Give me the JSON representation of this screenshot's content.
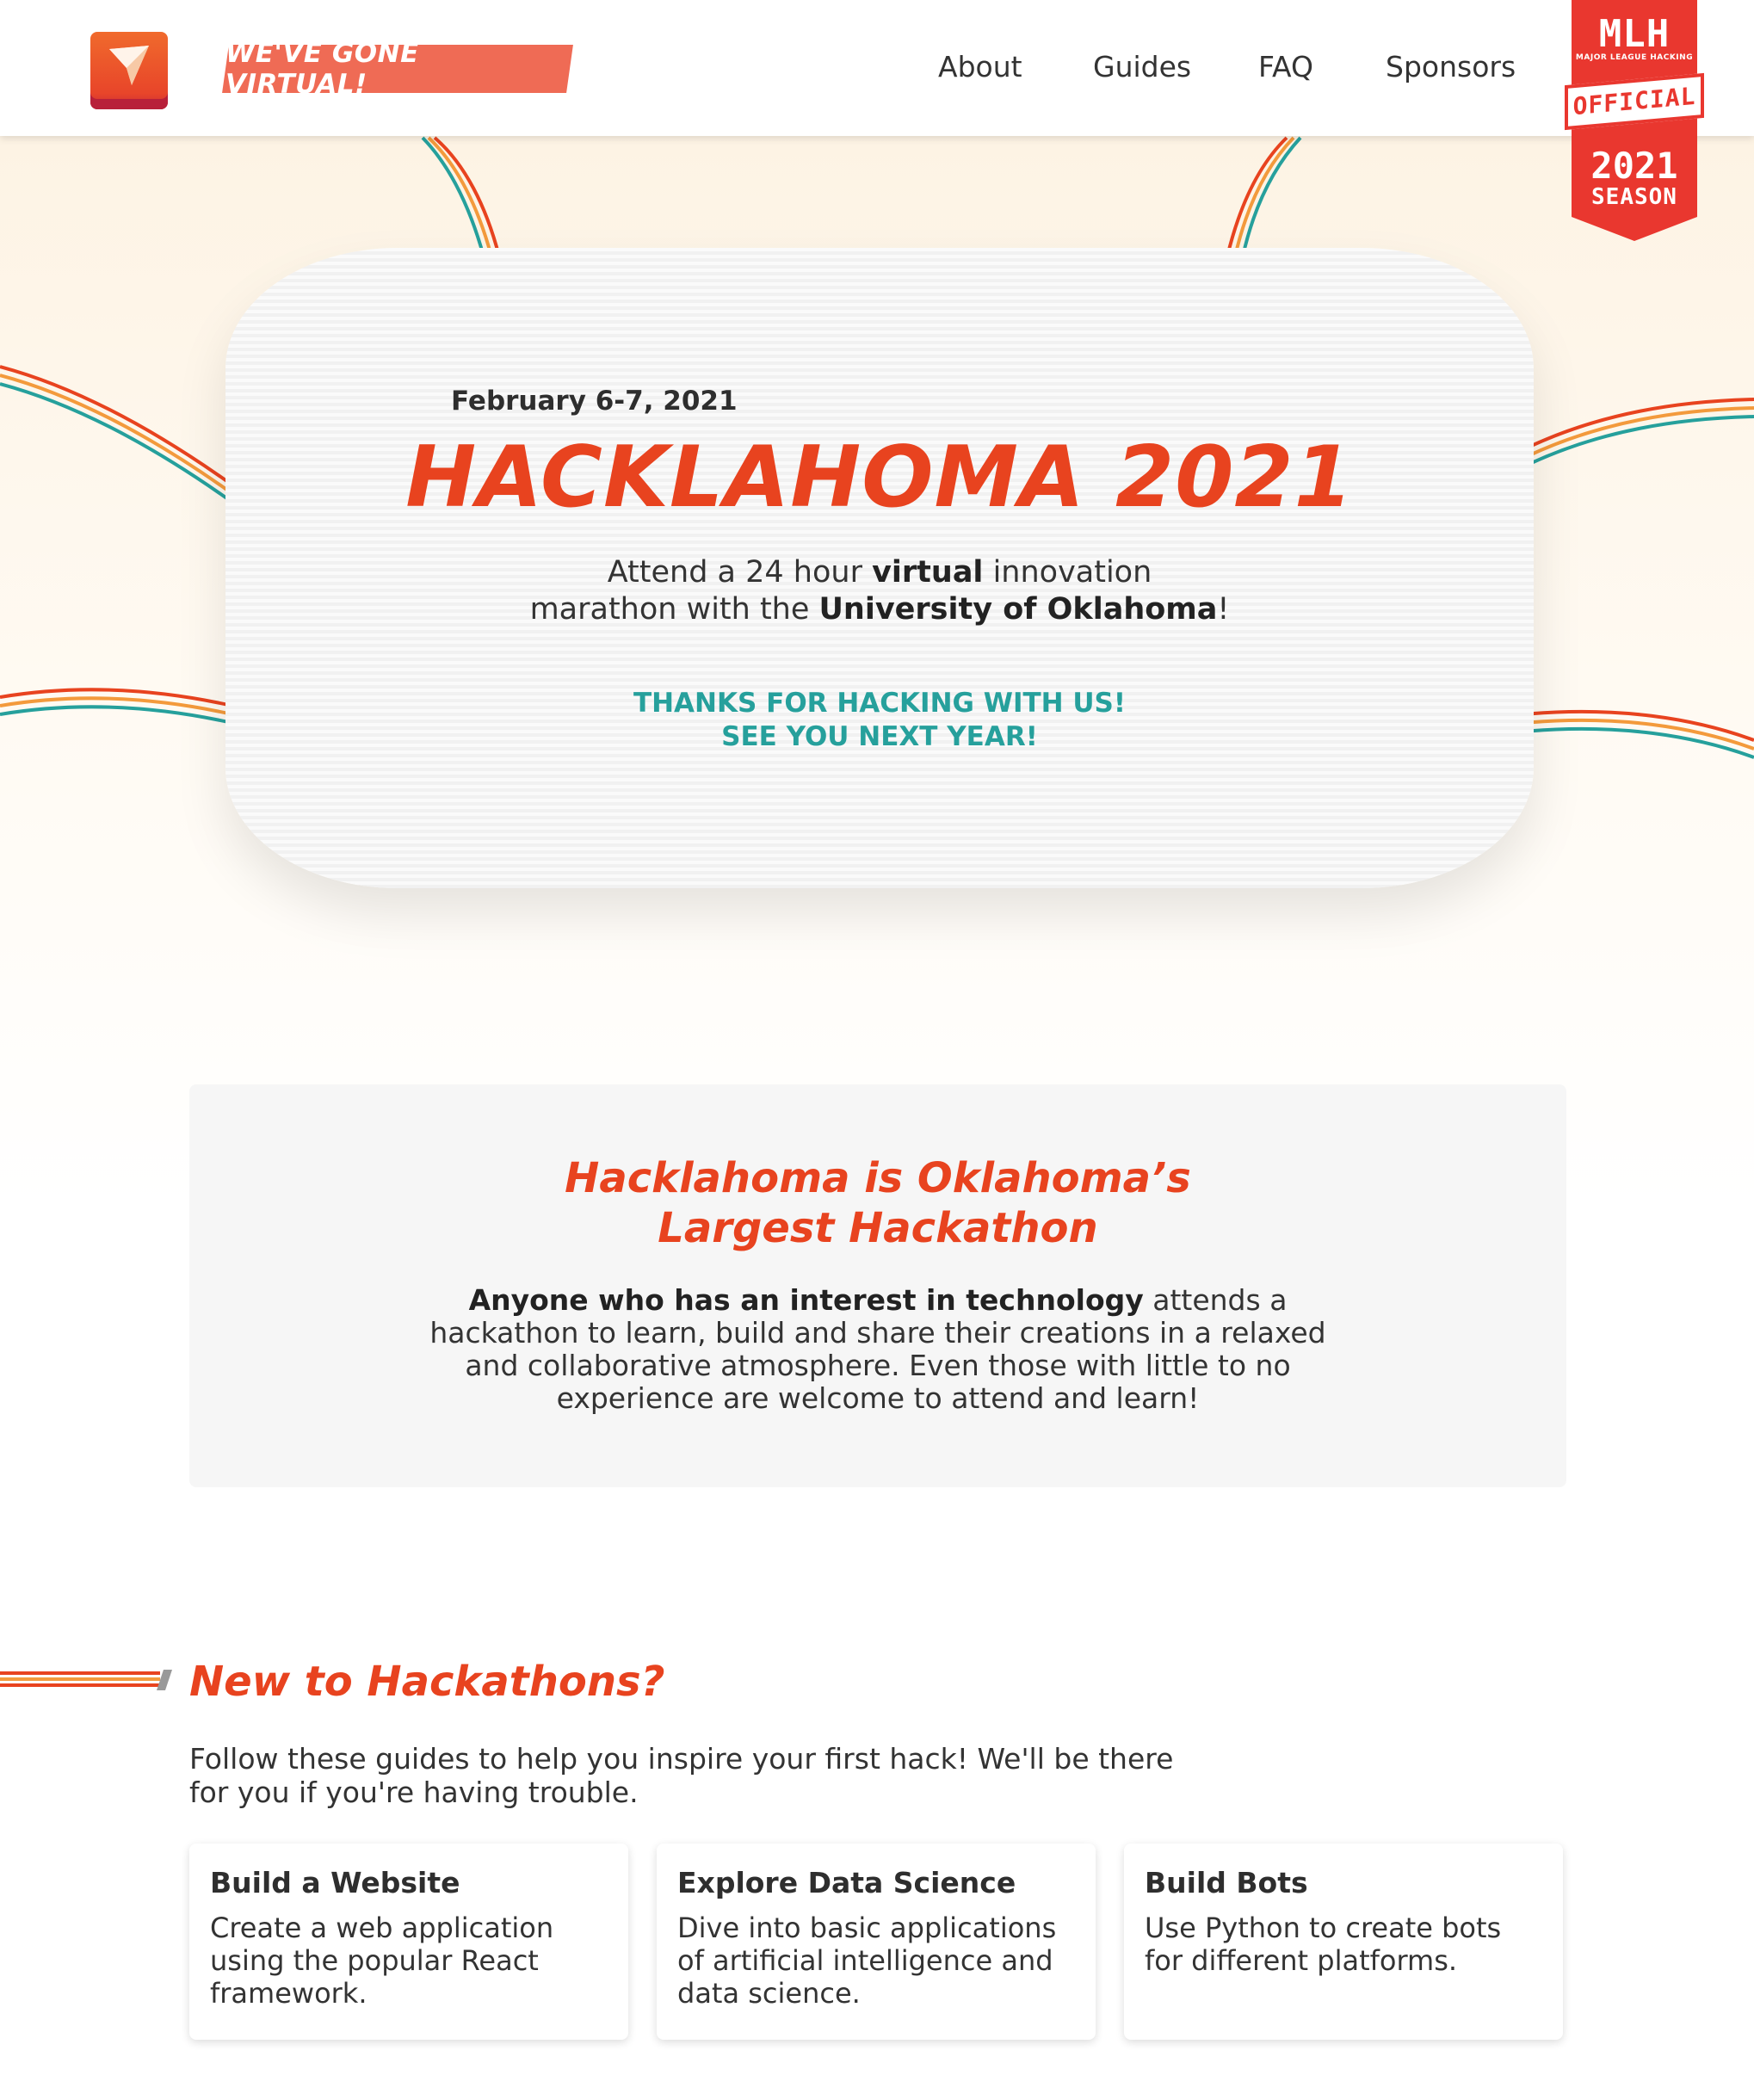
{
  "nav": {
    "badge": "WE'VE GONE VIRTUAL!",
    "links": [
      "About",
      "Guides",
      "FAQ",
      "Sponsors"
    ],
    "logo_icon": "paper-plane-icon"
  },
  "mlh": {
    "logo": "MLH",
    "subtitle": "MAJOR LEAGUE HACKING",
    "official": "OFFICIAL",
    "year": "2021",
    "season": "SEASON"
  },
  "hero": {
    "date": "February 6-7, 2021",
    "title": "HACKLAHOMA 2021",
    "desc_line1_pre": "Attend a 24 hour ",
    "desc_line1_bold": "virtual",
    "desc_line1_post": " innovation",
    "desc_line2_pre": "marathon with the ",
    "desc_line2_bold": "University of Oklahoma",
    "desc_line2_post": "!",
    "thanks_line1": "THANKS FOR HACKING WITH US!",
    "thanks_line2": "SEE YOU NEXT YEAR!"
  },
  "about": {
    "title_line1": "Hacklahoma is Oklahoma’s",
    "title_line2": "Largest Hackathon",
    "body_bold": "Anyone who has an interest in technology",
    "body_rest": " attends a hackathon to learn, build and share their creations in a relaxed and collaborative atmosphere. Even those with little to no experience are welcome to attend and learn!"
  },
  "guides": {
    "title": "New to Hackathons?",
    "intro": "Follow these guides to help you inspire your first hack! We'll be there for you if you're having trouble.",
    "cards": [
      {
        "title": "Build a Website",
        "text": "Create a web application using the popular React framework."
      },
      {
        "title": "Explore Data Science",
        "text": "Dive into basic applications of artificial intelligence and data science."
      },
      {
        "title": "Build Bots",
        "text": "Use Python to create bots for different platforms."
      }
    ]
  },
  "colors": {
    "accent": "#e8431f",
    "teal": "#26a09c",
    "badge": "#ef6b55",
    "mlh_red": "#e9372f"
  }
}
